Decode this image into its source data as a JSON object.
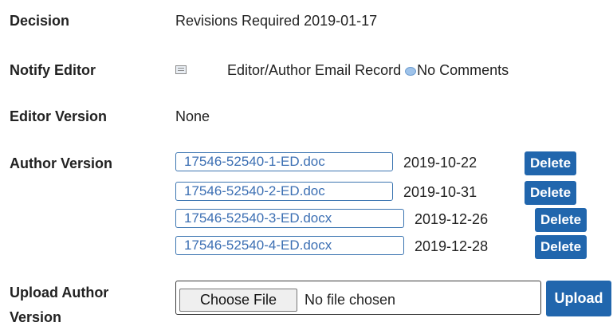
{
  "decision": {
    "label": "Decision",
    "value": "Revisions Required 2019-01-17"
  },
  "notify_editor": {
    "label": "Notify Editor",
    "email_icon": "mail-icon",
    "email_record": "Editor/Author Email Record",
    "comment_icon": "speech-bubble-icon",
    "comments": "No Comments"
  },
  "editor_version": {
    "label": "Editor Version",
    "value": "None"
  },
  "author_version": {
    "label": "Author Version",
    "files": [
      {
        "name": "17546-52540-1-ED.doc",
        "date": "2019-10-22",
        "delete_label": "Delete"
      },
      {
        "name": "17546-52540-2-ED.doc",
        "date": "2019-10-31",
        "delete_label": "Delete"
      },
      {
        "name": "17546-52540-3-ED.docx",
        "date": "2019-12-26",
        "delete_label": "Delete"
      },
      {
        "name": "17546-52540-4-ED.docx",
        "date": "2019-12-28",
        "delete_label": "Delete"
      }
    ]
  },
  "upload_author_version": {
    "label_line1": "Upload Author",
    "label_line2": "Version",
    "choose_label": "Choose File",
    "no_file": "No file chosen",
    "upload_label": "Upload"
  },
  "colors": {
    "link": "#3c6fb3",
    "button": "#2166ad"
  }
}
